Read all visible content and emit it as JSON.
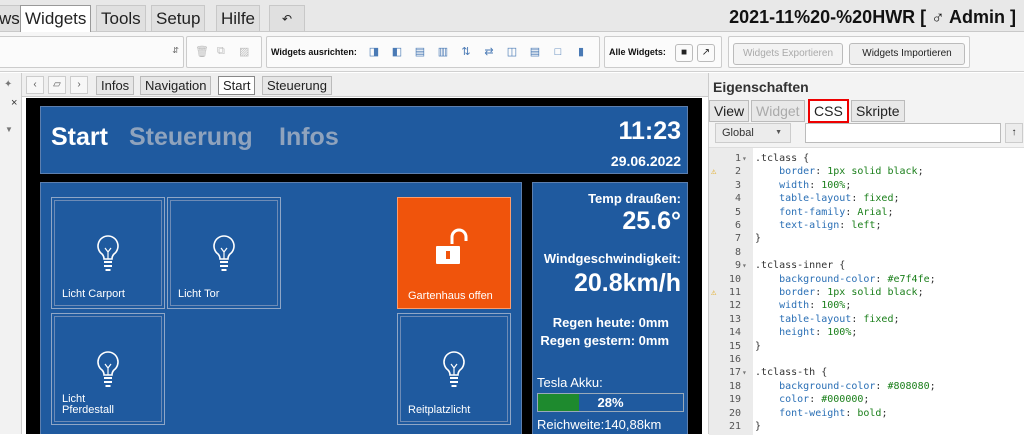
{
  "menubar": {
    "tabs": [
      {
        "label": "ws"
      },
      {
        "label": "Widgets"
      },
      {
        "label": "Tools"
      },
      {
        "label": "Setup"
      },
      {
        "label": "Hilfe"
      }
    ],
    "undo_icon": "undo-icon",
    "project_title": "2021-11%20-%20HWR [ ♂ Admin ]"
  },
  "toolbar": {
    "align_label": "Widgets ausrichten:",
    "all_widgets_label": "Alle Widgets:",
    "export_label": "Widgets Exportieren",
    "import_label": "Widgets Importieren"
  },
  "viewbar": {
    "tabs": [
      {
        "label": "Infos"
      },
      {
        "label": "Navigation"
      },
      {
        "label": "Start"
      },
      {
        "label": "Steuerung"
      }
    ]
  },
  "canvas": {
    "nav": {
      "start": "Start",
      "steuerung": "Steuerung",
      "infos": "Infos"
    },
    "time": "11:23",
    "date": "29.06.2022",
    "tiles": [
      {
        "label": "Licht Carport"
      },
      {
        "label": "Licht Tor"
      },
      {
        "label": "Gartenhaus offen"
      },
      {
        "label": "Licht Pferdestall"
      },
      {
        "label": "Reitplatzlicht"
      }
    ],
    "info": {
      "temp_label": "Temp draußen:",
      "temp_value": "25.6°",
      "wind_label": "Windgeschwindigkeit:",
      "wind_value": "20.8km/h",
      "rain_today": "Regen heute: 0mm",
      "rain_yesterday": "Regen gestern: 0mm",
      "battery_label": "Tesla Akku:",
      "battery_percent": 28,
      "battery_text": "28%",
      "range": "Reichweite:140,88km"
    },
    "colors": {
      "panel": "#1f5a9f",
      "accent_tile": "#f0540c",
      "battery_fill": "#1e8a2e"
    }
  },
  "props": {
    "title": "Eigenschaften",
    "tabs": [
      {
        "label": "View"
      },
      {
        "label": "Widget"
      },
      {
        "label": "CSS"
      },
      {
        "label": "Skripte"
      }
    ],
    "scope": "Global",
    "lines": [
      {
        "n": "1",
        "fold": true,
        "warn": false,
        "parts": [
          [
            "c-sel",
            ".tclass "
          ],
          [
            "c-br",
            "{"
          ]
        ]
      },
      {
        "n": "2",
        "fold": false,
        "warn": true,
        "parts": [
          [
            "c-prop",
            "    border"
          ],
          [
            "c-br",
            ": "
          ],
          [
            "c-val",
            "1px solid black"
          ],
          [
            "c-br",
            ";"
          ]
        ]
      },
      {
        "n": "3",
        "fold": false,
        "warn": false,
        "parts": [
          [
            "c-prop",
            "    width"
          ],
          [
            "c-br",
            ": "
          ],
          [
            "c-val",
            "100%"
          ],
          [
            "c-br",
            ";"
          ]
        ]
      },
      {
        "n": "4",
        "fold": false,
        "warn": false,
        "parts": [
          [
            "c-prop",
            "    table-layout"
          ],
          [
            "c-br",
            ": "
          ],
          [
            "c-val",
            "fixed"
          ],
          [
            "c-br",
            ";"
          ]
        ]
      },
      {
        "n": "5",
        "fold": false,
        "warn": false,
        "parts": [
          [
            "c-prop",
            "    font-family"
          ],
          [
            "c-br",
            ": "
          ],
          [
            "c-val",
            "Arial"
          ],
          [
            "c-br",
            ";"
          ]
        ]
      },
      {
        "n": "6",
        "fold": false,
        "warn": false,
        "parts": [
          [
            "c-prop",
            "    text-align"
          ],
          [
            "c-br",
            ": "
          ],
          [
            "c-val",
            "left"
          ],
          [
            "c-br",
            ";"
          ]
        ]
      },
      {
        "n": "7",
        "fold": false,
        "warn": false,
        "parts": [
          [
            "c-br",
            "}"
          ]
        ]
      },
      {
        "n": "8",
        "fold": false,
        "warn": false,
        "parts": []
      },
      {
        "n": "9",
        "fold": true,
        "warn": false,
        "parts": [
          [
            "c-sel",
            ".tclass-inner "
          ],
          [
            "c-br",
            "{"
          ]
        ]
      },
      {
        "n": "10",
        "fold": false,
        "warn": false,
        "parts": [
          [
            "c-prop",
            "    background-color"
          ],
          [
            "c-br",
            ": "
          ],
          [
            "c-val",
            "#e7f4fe"
          ],
          [
            "c-br",
            ";"
          ]
        ]
      },
      {
        "n": "11",
        "fold": false,
        "warn": true,
        "parts": [
          [
            "c-prop",
            "    border"
          ],
          [
            "c-br",
            ": "
          ],
          [
            "c-val",
            "1px solid black"
          ],
          [
            "c-br",
            ";"
          ]
        ]
      },
      {
        "n": "12",
        "fold": false,
        "warn": false,
        "parts": [
          [
            "c-prop",
            "    width"
          ],
          [
            "c-br",
            ": "
          ],
          [
            "c-val",
            "100%"
          ],
          [
            "c-br",
            ";"
          ]
        ]
      },
      {
        "n": "13",
        "fold": false,
        "warn": false,
        "parts": [
          [
            "c-prop",
            "    table-layout"
          ],
          [
            "c-br",
            ": "
          ],
          [
            "c-val",
            "fixed"
          ],
          [
            "c-br",
            ";"
          ]
        ]
      },
      {
        "n": "14",
        "fold": false,
        "warn": false,
        "parts": [
          [
            "c-prop",
            "    height"
          ],
          [
            "c-br",
            ": "
          ],
          [
            "c-val",
            "100%"
          ],
          [
            "c-br",
            ";"
          ]
        ]
      },
      {
        "n": "15",
        "fold": false,
        "warn": false,
        "parts": [
          [
            "c-br",
            "}"
          ]
        ]
      },
      {
        "n": "16",
        "fold": false,
        "warn": false,
        "parts": []
      },
      {
        "n": "17",
        "fold": true,
        "warn": false,
        "parts": [
          [
            "c-sel",
            ".tclass-th "
          ],
          [
            "c-br",
            "{"
          ]
        ]
      },
      {
        "n": "18",
        "fold": false,
        "warn": false,
        "parts": [
          [
            "c-prop",
            "    background-color"
          ],
          [
            "c-br",
            ": "
          ],
          [
            "c-val",
            "#808080"
          ],
          [
            "c-br",
            ";"
          ]
        ]
      },
      {
        "n": "19",
        "fold": false,
        "warn": false,
        "parts": [
          [
            "c-prop",
            "    color"
          ],
          [
            "c-br",
            ": "
          ],
          [
            "c-val",
            "#000000"
          ],
          [
            "c-br",
            ";"
          ]
        ]
      },
      {
        "n": "20",
        "fold": false,
        "warn": false,
        "parts": [
          [
            "c-prop",
            "    font-weight"
          ],
          [
            "c-br",
            ": "
          ],
          [
            "c-val",
            "bold"
          ],
          [
            "c-br",
            ";"
          ]
        ]
      },
      {
        "n": "21",
        "fold": false,
        "warn": false,
        "parts": [
          [
            "c-br",
            "}"
          ]
        ]
      }
    ]
  }
}
